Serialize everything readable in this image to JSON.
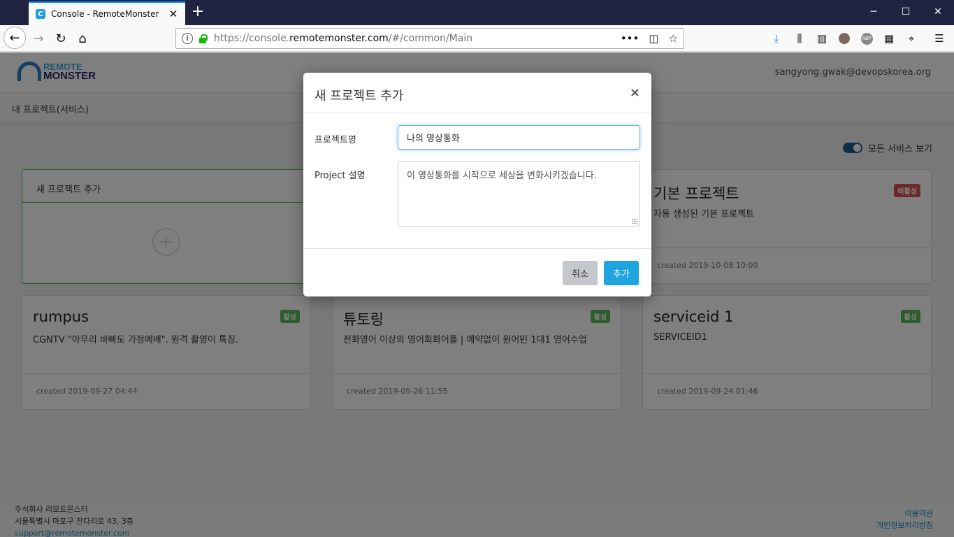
{
  "browser": {
    "tab_title": "Console - RemoteMonster",
    "tab_favicon": "C",
    "url_prefix": "https://console.",
    "url_domain": "remotemonster.com",
    "url_path": "/#/common/Main"
  },
  "header": {
    "logo_line1": "REMOTE",
    "logo_line2": "MONSTER",
    "user_email": "sangyong.gwak@devopskorea.org"
  },
  "subnav": {
    "title": "내 프로젝트(서비스)"
  },
  "toggle": {
    "label": "모든 서비스 보기",
    "on": true
  },
  "add_card": {
    "title": "새 프로젝트 추가"
  },
  "projects": [
    {
      "title": "기본 프로젝트",
      "description": "자동 생성된 기본 프로젝트",
      "badge": "비활성",
      "badge_color": "#d9534f",
      "created": "created 2019-10-08 10:00"
    },
    {
      "title": "rumpus",
      "description": "CGNTV \"아무리 바빠도 가정예배\". 원격 촬영이 특징.",
      "badge": "활성",
      "badge_color": "#5cb85c",
      "created": "created 2019-09-27 04:44"
    },
    {
      "title": "튜토링",
      "description": "전화영어 이상의 영어회화어플 | 예약없이 원어민 1대1 영어수업",
      "badge": "활성",
      "badge_color": "#5cb85c",
      "created": "created 2019-09-26 11:55"
    },
    {
      "title": "serviceid 1",
      "description": "SERVICEID1",
      "badge": "활성",
      "badge_color": "#5cb85c",
      "created": "created 2019-09-24 01:46"
    }
  ],
  "footer": {
    "company": "주식회사 리모트몬스터",
    "address": "서울특별시 마포구 잔다리로 43, 3층",
    "email": "support@remotemonster.com",
    "terms": "이용약관",
    "privacy": "개인정보처리방침"
  },
  "modal": {
    "title": "새 프로젝트 추가",
    "close": "×",
    "name_label": "프로젝트명",
    "name_value": "나의 영상통화",
    "desc_label": "Project 설명",
    "desc_value": "이 영상통화를 시작으로 세상을 변화시키겠습니다.",
    "cancel_label": "취소",
    "add_label": "추가"
  }
}
